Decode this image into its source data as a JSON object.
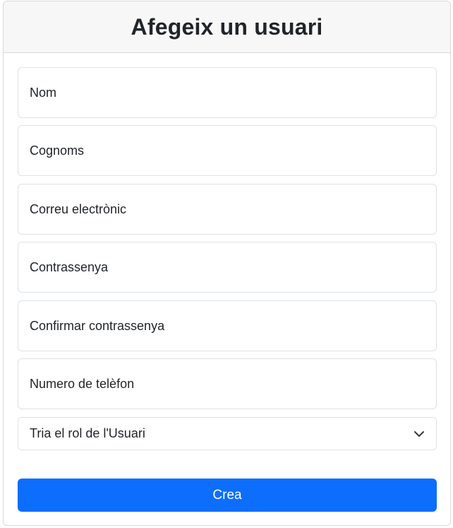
{
  "form": {
    "title": "Afegeix un usuari",
    "fields": [
      {
        "placeholder": "Nom"
      },
      {
        "placeholder": "Cognoms"
      },
      {
        "placeholder": "Correu electrònic"
      },
      {
        "placeholder": "Contrassenya"
      },
      {
        "placeholder": "Confirmar contrassenya"
      },
      {
        "placeholder": "Numero de telèfon"
      }
    ],
    "role_select": {
      "selected": "Tria el rol de l'Usuari",
      "icon": "chevron-down-icon"
    },
    "submit_label": "Crea"
  },
  "colors": {
    "primary": "#0d6efd",
    "header_bg": "#f7f7f7",
    "border": "#dee2e6",
    "text": "#212529"
  }
}
